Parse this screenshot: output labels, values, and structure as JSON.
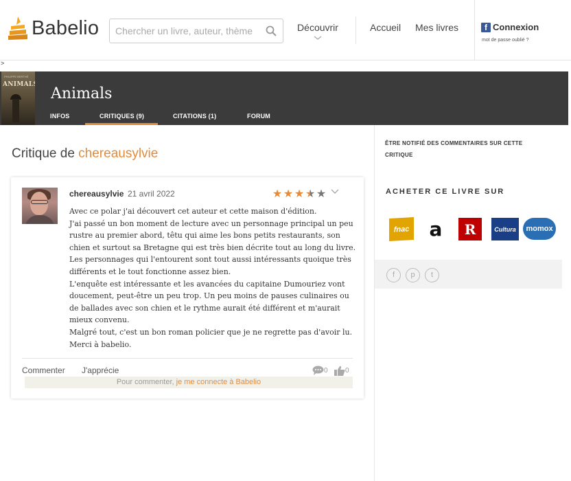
{
  "header": {
    "logo_text": "Babelio",
    "search_placeholder": "Chercher un livre, auteur, thème",
    "nav_discover": "Découvrir",
    "nav_home": "Accueil",
    "nav_my_books": "Mes livres",
    "facebook_glyph": "f",
    "login_label": "Connexion",
    "forgot_password": "mot de passe oublié ?",
    "breadcrumb_marker": ">"
  },
  "book": {
    "title": "Animals",
    "cover_title": "ANIMALS",
    "cover_author": "PHILIPPE BERTHÉ",
    "tabs": [
      {
        "label": "INFOS"
      },
      {
        "label": "CRITIQUES (9)"
      },
      {
        "label": "CITATIONS (1)"
      },
      {
        "label": "FORUM"
      }
    ],
    "active_tab_index": 1
  },
  "page": {
    "title_prefix": "Critique de",
    "title_user": "chereausylvie"
  },
  "review": {
    "author": "chereausylvie",
    "date": "21 avril 2022",
    "rating": 3.5,
    "rating_max": 5,
    "paragraphs": [
      "Avec ce polar j'ai découvert cet auteur et cette maison d'édition.",
      "J'ai passé un bon moment de lecture avec un personnage principal un peu rustre au premier abord, têtu qui aime les bons petits restaurants, son chien et surtout sa Bretagne qui est très bien décrite tout au long du livre.",
      "Les personnages qui l'entourent sont tout aussi intéressants quoique très différents et le tout fonctionne assez bien.",
      "L'enquête est intéressante et les avancées du capitaine Dumouriez vont doucement, peut-être un peu trop. Un peu moins de pauses culinaires ou de ballades avec son chien et le rythme aurait été différent et m'aurait mieux convenu.",
      "Malgré tout, c'est un bon roman policier que je ne regrette pas d'avoir lu.",
      "Merci à babelio."
    ],
    "comment_label": "Commenter",
    "appreciate_label": "J'apprécie",
    "comment_count": "0",
    "like_count": "0",
    "connect_prefix": "Pour commenter,",
    "connect_link": "je me connecte à Babelio"
  },
  "sidebar": {
    "notify_text": "ÊTRE NOTIFIÉ DES COMMENTAIRES SUR CETTE CRITIQUE",
    "buy_title": "ACHETER CE LIVRE SUR",
    "stores": [
      {
        "name": "fnac",
        "label": "fnac"
      },
      {
        "name": "amazon",
        "label": "a"
      },
      {
        "name": "rakuten",
        "label": "R"
      },
      {
        "name": "cultura",
        "label": "Cultura"
      },
      {
        "name": "momox",
        "label": "momox"
      }
    ],
    "social": [
      {
        "name": "facebook",
        "glyph": "f"
      },
      {
        "name": "pinterest",
        "glyph": "p"
      },
      {
        "name": "twitter",
        "glyph": "t"
      }
    ]
  },
  "colors": {
    "accent": "#e48b3b",
    "banner": "#3b3b3b",
    "star_empty": "#777777"
  }
}
